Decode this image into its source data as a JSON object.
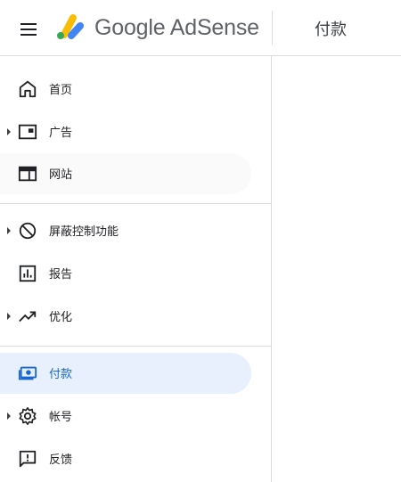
{
  "app": {
    "logo_text": "Google AdSense",
    "page_title": "付款"
  },
  "icons": {
    "menu": "hamburger-menu-icon",
    "logo": "adsense-logo-icon"
  },
  "colors": {
    "active_bg": "#e8f0fe",
    "active_text": "#1967d2",
    "logo_yellow": "#fbbc04",
    "logo_blue": "#4285f4",
    "logo_green": "#34a853"
  },
  "sidebar": {
    "items": [
      {
        "label": "首页",
        "icon": "home-icon",
        "expandable": false,
        "active": false
      },
      {
        "label": "广告",
        "icon": "ads-icon",
        "expandable": true,
        "active": false
      },
      {
        "label": "网站",
        "icon": "sites-icon",
        "expandable": false,
        "active": false
      },
      {
        "label": "屏蔽控制功能",
        "icon": "block-icon",
        "expandable": true,
        "active": false
      },
      {
        "label": "报告",
        "icon": "reports-icon",
        "expandable": false,
        "active": false
      },
      {
        "label": "优化",
        "icon": "trending-icon",
        "expandable": true,
        "active": false
      },
      {
        "label": "付款",
        "icon": "payments-icon",
        "expandable": false,
        "active": true
      },
      {
        "label": "帐号",
        "icon": "gear-icon",
        "expandable": true,
        "active": false
      },
      {
        "label": "反馈",
        "icon": "feedback-icon",
        "expandable": false,
        "active": false
      }
    ]
  }
}
